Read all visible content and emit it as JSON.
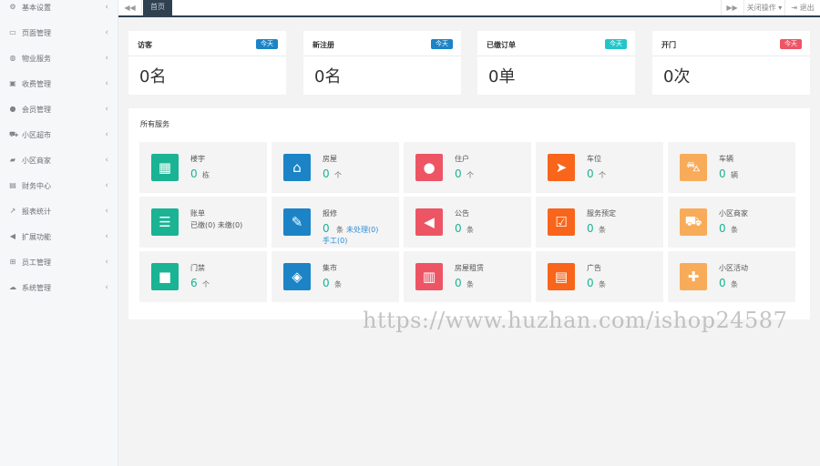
{
  "sidebar": {
    "items": [
      {
        "label": "基本设置",
        "icon": "gear-icon",
        "glyph": "⚙"
      },
      {
        "label": "页面管理",
        "icon": "window-icon",
        "glyph": "▭"
      },
      {
        "label": "物业服务",
        "icon": "globe-icon",
        "glyph": "◍"
      },
      {
        "label": "收费管理",
        "icon": "money-icon",
        "glyph": "▣"
      },
      {
        "label": "会员管理",
        "icon": "user-icon",
        "glyph": "●"
      },
      {
        "label": "小区超市",
        "icon": "cart-icon",
        "glyph": "⛟"
      },
      {
        "label": "小区商家",
        "icon": "truck-icon",
        "glyph": "▰"
      },
      {
        "label": "财务中心",
        "icon": "book-icon",
        "glyph": "▤"
      },
      {
        "label": "报表统计",
        "icon": "chart-icon",
        "glyph": "↗"
      },
      {
        "label": "扩展功能",
        "icon": "reply-icon",
        "glyph": "◀"
      },
      {
        "label": "员工管理",
        "icon": "sitemap-icon",
        "glyph": "⊞"
      },
      {
        "label": "系统管理",
        "icon": "cloud-icon",
        "glyph": "☁"
      }
    ]
  },
  "topbar": {
    "back_glyph": "◀◀",
    "active_tab": "首页",
    "forward_glyph": "▶▶",
    "close_label": "关闭操作",
    "logout_label": "退出"
  },
  "stats": [
    {
      "title": "访客",
      "badge": "今天",
      "value": "0名",
      "color": "#1c84c6"
    },
    {
      "title": "新注册",
      "badge": "今天",
      "value": "0名",
      "color": "#1c84c6"
    },
    {
      "title": "已缴订单",
      "badge": "今天",
      "value": "0单",
      "color": "#23c6c8"
    },
    {
      "title": "开门",
      "badge": "今天",
      "value": "0次",
      "color": "#ed5565"
    }
  ],
  "panel": {
    "title": "所有服务",
    "services": [
      {
        "name": "楼宇",
        "value": "0",
        "unit": "栋",
        "color": "#1ab394",
        "icon": "building-icon",
        "glyph": "▦"
      },
      {
        "name": "房屋",
        "value": "0",
        "unit": "个",
        "color": "#1c84c6",
        "icon": "home-icon",
        "glyph": "⌂"
      },
      {
        "name": "住户",
        "value": "0",
        "unit": "个",
        "color": "#ed5565",
        "icon": "user-icon",
        "glyph": "●"
      },
      {
        "name": "车位",
        "value": "0",
        "unit": "个",
        "color": "#f8651b",
        "icon": "paper-plane-icon",
        "glyph": "➤"
      },
      {
        "name": "车辆",
        "value": "0",
        "unit": "辆",
        "color": "#f8ac59",
        "icon": "car-icon",
        "glyph": "⛍"
      },
      {
        "name": "账单",
        "sub": "已缴(0) 未缴(0)",
        "color": "#1ab394",
        "icon": "list-icon",
        "glyph": "☰"
      },
      {
        "name": "报修",
        "value": "0",
        "unit": "条",
        "extra": "未处理(0)",
        "extra2": "手工(0)",
        "color": "#1c84c6",
        "icon": "wrench-icon",
        "glyph": "✎"
      },
      {
        "name": "公告",
        "value": "0",
        "unit": "条",
        "color": "#ed5565",
        "icon": "bullhorn-icon",
        "glyph": "◀"
      },
      {
        "name": "服务预定",
        "value": "0",
        "unit": "条",
        "color": "#f8651b",
        "icon": "calendar-check-icon",
        "glyph": "☑"
      },
      {
        "name": "小区商家",
        "value": "0",
        "unit": "条",
        "color": "#f8ac59",
        "icon": "cart-icon",
        "glyph": "⛟"
      },
      {
        "name": "门禁",
        "value": "6",
        "unit": "个",
        "color": "#1ab394",
        "icon": "lock-icon",
        "glyph": "■"
      },
      {
        "name": "集市",
        "value": "0",
        "unit": "条",
        "color": "#1c84c6",
        "icon": "cube-icon",
        "glyph": "◈"
      },
      {
        "name": "房屋租赁",
        "value": "0",
        "unit": "条",
        "color": "#ed5565",
        "icon": "bank-icon",
        "glyph": "▥"
      },
      {
        "name": "广告",
        "value": "0",
        "unit": "条",
        "color": "#f8651b",
        "icon": "newspaper-icon",
        "glyph": "▤"
      },
      {
        "name": "小区活动",
        "value": "0",
        "unit": "条",
        "color": "#f8ac59",
        "icon": "gift-icon",
        "glyph": "✚"
      }
    ]
  },
  "watermark": "https://www.huzhan.com/ishop24587"
}
